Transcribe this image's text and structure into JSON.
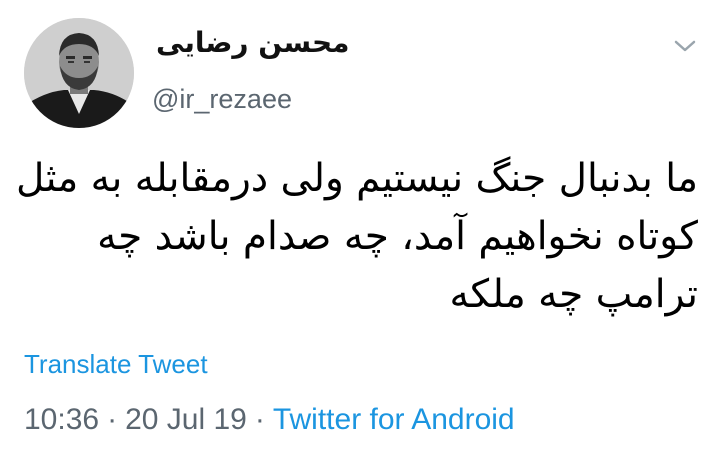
{
  "author": {
    "display_name": "محسن رضایی",
    "handle": "@ir_rezaee"
  },
  "tweet": {
    "lines": [
      "ما بدنبال جنگ نیستیم ولی درمقابله به مثل",
      "کوتاه نخواهیم آمد، چه صدام باشد چه",
      "ترامپ چه ملکه"
    ]
  },
  "actions": {
    "translate_label": "Translate Tweet",
    "more_icon": "chevron-down-icon"
  },
  "meta": {
    "time": "10:36",
    "separator": "·",
    "date": "20 Jul 19",
    "source": "Twitter for Android"
  },
  "colors": {
    "link": "#1b95e0",
    "secondary_text": "#5b6670",
    "text": "#000000",
    "background": "#ffffff"
  }
}
